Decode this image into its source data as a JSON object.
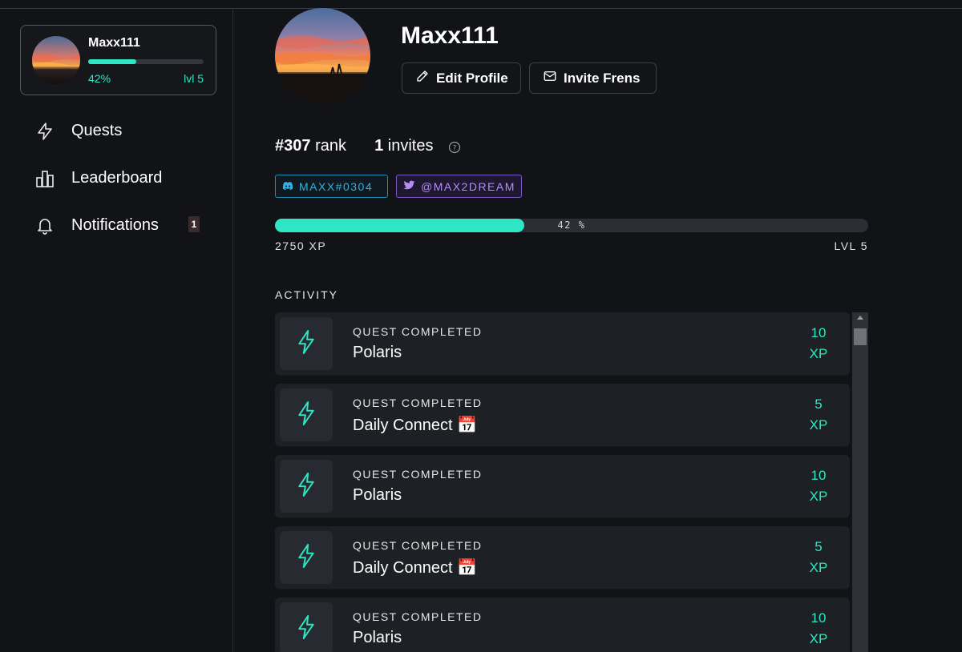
{
  "sidebar": {
    "user": {
      "name": "Maxx111",
      "progress": 0.42,
      "percent_label": "42%",
      "level_label": "lvl 5"
    },
    "nav": [
      {
        "label": "Quests",
        "icon": "lightning-icon"
      },
      {
        "label": "Leaderboard",
        "icon": "leaderboard-icon"
      },
      {
        "label": "Notifications",
        "icon": "bell-icon",
        "badge": "1"
      }
    ]
  },
  "profile": {
    "name": "Maxx111",
    "edit_label": "Edit Profile",
    "invite_label": "Invite Frens",
    "rank_value": "#307",
    "rank_label": "rank",
    "invites_value": "1",
    "invites_label": "invites",
    "discord": "MAXX#0304",
    "twitter": "@MAX2DREAM",
    "xp_progress": 0.42,
    "xp_percent_label": "42 %",
    "xp_label": "2750 XP",
    "level_label": "LVL 5"
  },
  "activity": {
    "title": "ACTIVITY",
    "items": [
      {
        "type": "QUEST COMPLETED",
        "name": "Polaris",
        "xp": "10",
        "unit": "XP"
      },
      {
        "type": "QUEST COMPLETED",
        "name": "Daily Connect 📅",
        "xp": "5",
        "unit": "XP"
      },
      {
        "type": "QUEST COMPLETED",
        "name": "Polaris",
        "xp": "10",
        "unit": "XP"
      },
      {
        "type": "QUEST COMPLETED",
        "name": "Daily Connect 📅",
        "xp": "5",
        "unit": "XP"
      },
      {
        "type": "QUEST COMPLETED",
        "name": "Polaris",
        "xp": "10",
        "unit": "XP"
      }
    ]
  },
  "colors": {
    "accent": "#2ee6c4",
    "background": "#111317",
    "card": "#1d2024",
    "discord": "#2fb2e0",
    "twitter": "#b48df2"
  }
}
